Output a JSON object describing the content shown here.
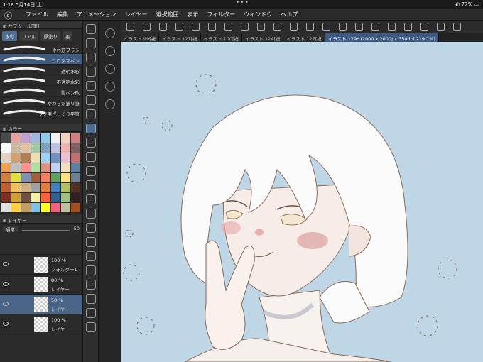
{
  "status": {
    "time": "1:18",
    "date": "5月14日(土)",
    "battery": "77%"
  },
  "menu": {
    "items": [
      "ファイル",
      "編集",
      "アニメーション",
      "レイヤー",
      "選択範囲",
      "表示",
      "フィルター",
      "ウィンドウ",
      "ヘルプ"
    ]
  },
  "subtool_panel": {
    "title": "サブツール[筆]",
    "tabs": [
      "水彩",
      "リアル",
      "厚塗り",
      "墨"
    ],
    "brushes": [
      "やわ筋ブラシ",
      "クロヌマペン",
      "透明水彩",
      "不透明水彩",
      "影ペン改",
      "やわらか塗り筆",
      "ラフ用ざっくり平筆"
    ]
  },
  "color_panel": {
    "title": "カラー",
    "swatches": [
      "#4a4a4a",
      "#e8a0a0",
      "#c0a0d0",
      "#a0b8e0",
      "#90c8e8",
      "#f0f0f0",
      "#f4d0c0",
      "#d08080",
      "#ffffff",
      "#c8b8a0",
      "#e0c0a0",
      "#a0c8a0",
      "#80a0c0",
      "#c0c0e0",
      "#f0b0b0",
      "#806060",
      "#e0d0c0",
      "#d0a070",
      "#b08050",
      "#e8e0b0",
      "#a0d0f0",
      "#7090c0",
      "#f0c0d0",
      "#c07070",
      "#f0a050",
      "#c0c0c0",
      "#ff9090",
      "#b0e0a0",
      "#e09080",
      "#c0d0f0",
      "#f0e0c0",
      "#6080a0",
      "#d08040",
      "#e0e040",
      "#8090b0",
      "#a06040",
      "#f08060",
      "#60a060",
      "#ffe080",
      "#708090",
      "#c06030",
      "#f0c060",
      "#d0b080",
      "#a0a0a0",
      "#e08040",
      "#4080c0",
      "#b0c060",
      "#503020",
      "#803020",
      "#d0a030",
      "#705040",
      "#f0f0a0",
      "#ff6040",
      "#306090",
      "#a0c080",
      "#302020",
      "#e0e0e0",
      "#ffd040",
      "#c0a060",
      "#80c0e0",
      "#ffff20",
      "#f06080",
      "#c0c0a0",
      "#a05020"
    ]
  },
  "layer_panel": {
    "title": "レイヤー",
    "blend": "通常",
    "opacity": "50",
    "layers": [
      {
        "pct": "100 %",
        "name": "フォルダー1"
      },
      {
        "pct": "80 %",
        "name": "レイヤー"
      },
      {
        "pct": "50 %",
        "name": "レイヤー"
      },
      {
        "pct": "100 %",
        "name": "レイヤー"
      }
    ]
  },
  "tabs": [
    "イラスト 99[複",
    "イラスト 121[複",
    "イラスト 100[複",
    "イラスト 124[複",
    "イラスト 127[複",
    "イラスト 129* (2000 x 2000px 350dpi 219.7%)"
  ]
}
